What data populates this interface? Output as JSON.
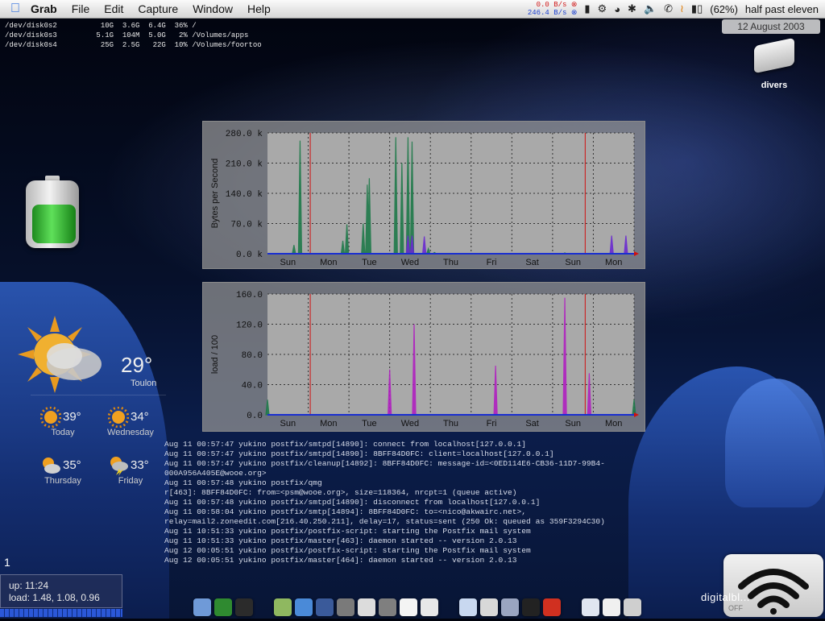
{
  "menubar": {
    "app_name": "Grab",
    "menus": [
      "File",
      "Edit",
      "Capture",
      "Window",
      "Help"
    ],
    "net_out": "0.0 B/s",
    "net_in": "246.4 B/s",
    "battery_percent": "(62%)",
    "clock": "half past eleven"
  },
  "date_widget": {
    "date": "12 August 2003"
  },
  "desktop": {
    "drive_label": "divers"
  },
  "df_output": [
    "/dev/disk0s2          10G  3.6G  6.4G  36% /",
    "/dev/disk0s3         5.1G  104M  5.0G   2% /Volumes/apps",
    "/dev/disk0s4          25G  2.5G   22G  10% /Volumes/foortoo"
  ],
  "battery_widget": {
    "level": 0.62
  },
  "network_graph": {
    "chart_data": {
      "type": "area",
      "ylabel": "Bytes per Second",
      "yticks": [
        "0.0 k",
        "70.0 k",
        "140.0 k",
        "210.0 k",
        "280.0 k"
      ],
      "ylim": [
        0,
        280
      ],
      "categories": [
        "Sun",
        "Mon",
        "Tue",
        "Wed",
        "Thu",
        "Fri",
        "Sat",
        "Sun",
        "Mon"
      ],
      "series": [
        {
          "color": "#1f7a4a",
          "points": [
            [
              0.65,
              20
            ],
            [
              0.8,
              262
            ],
            [
              1.85,
              30
            ],
            [
              1.95,
              68
            ],
            [
              2.35,
              70
            ],
            [
              2.45,
              160
            ],
            [
              2.5,
              175
            ],
            [
              3.15,
              270
            ],
            [
              3.3,
              210
            ],
            [
              3.45,
              270
            ],
            [
              3.55,
              260
            ],
            [
              3.95,
              12
            ],
            [
              4.1,
              3
            ],
            [
              7.3,
              2
            ]
          ]
        },
        {
          "color": "#6a2ad0",
          "points": [
            [
              3.45,
              42
            ],
            [
              3.55,
              42
            ],
            [
              3.85,
              40
            ],
            [
              4.0,
              0
            ],
            [
              8.45,
              42
            ],
            [
              8.8,
              42
            ]
          ]
        }
      ]
    }
  },
  "load_graph": {
    "chart_data": {
      "type": "area",
      "ylabel": "load / 100",
      "yticks": [
        "0.0",
        "40.0",
        "80.0",
        "120.0",
        "160.0"
      ],
      "ylim": [
        0,
        160
      ],
      "categories": [
        "Sun",
        "Mon",
        "Tue",
        "Wed",
        "Thu",
        "Fri",
        "Sat",
        "Sun",
        "Mon"
      ],
      "series": [
        {
          "color": "#b020c0",
          "points": [
            [
              3.6,
              120
            ],
            [
              7.3,
              155
            ],
            [
              3.0,
              60
            ],
            [
              5.6,
              65
            ],
            [
              7.9,
              55
            ]
          ]
        },
        {
          "color": "#1f7a4a",
          "points": [
            [
              0,
              20
            ],
            [
              9,
              20
            ]
          ]
        }
      ]
    }
  },
  "weather": {
    "current_temp": "29°",
    "city": "Toulon",
    "forecast": [
      {
        "day": "Today",
        "temp": "39°"
      },
      {
        "day": "Wednesday",
        "temp": "34°"
      },
      {
        "day": "Thursday",
        "temp": "35°"
      },
      {
        "day": "Friday",
        "temp": "33°"
      }
    ]
  },
  "log_lines": [
    "Aug 11 00:57:47 yukino postfix/smtpd[14890]: connect from localhost[127.0.0.1]",
    "Aug 11 00:57:47 yukino postfix/smtpd[14890]: 8BFF84D0FC: client=localhost[127.0.0.1]",
    "Aug 11 00:57:47 yukino postfix/cleanup[14892]: 8BFF84D0FC: message-id=<0ED114E6-CB36-11D7-99B4-",
    "000A956A405E@wooe.org>",
    "Aug 11 00:57:48 yukino postfix/qmg",
    "r[463]: 8BFF84D0FC: from=<psm@wooe.org>, size=118364, nrcpt=1 (queue active)",
    "Aug 11 00:57:48 yukino postfix/smtpd[14890]: disconnect from localhost[127.0.0.1]",
    "Aug 11 00:58:04 yukino postfix/smtp[14894]: 8BFF84D0FC: to=<nico@akwairc.net>,",
    "relay=mail2.zoneedit.com[216.40.250.211], delay=17, status=sent (250 Ok: queued as 359F3294C30)",
    "Aug 11 10:51:33 yukino postfix/postfix-script: starting the Postfix mail system",
    "Aug 11 10:51:33 yukino postfix/master[463]: daemon started -- version 2.0.13",
    "Aug 12 00:05:51 yukino postfix/postfix-script: starting the Postfix mail system",
    "Aug 12 00:05:51 yukino postfix/master[464]: daemon started -- version 2.0.13"
  ],
  "workspace_number": "1",
  "uptime": {
    "up": "up: 11:24",
    "load": "load: 1.48, 1.08, 0.96"
  },
  "dock": {
    "items": [
      {
        "icon": "finder-icon",
        "color": "#6f9ad8"
      },
      {
        "icon": "activity-monitor-icon",
        "color": "#2f8a30"
      },
      {
        "icon": "terminal-icon",
        "color": "#2b2b2b"
      },
      {
        "icon": "mail-icon",
        "color": "#8fb860"
      },
      {
        "icon": "safari-icon",
        "color": "#4a8ad8"
      },
      {
        "icon": "sherlock-icon",
        "color": "#3a5a9a"
      },
      {
        "icon": "system-prefs-icon",
        "color": "#7a7a7a"
      },
      {
        "icon": "ichat-icon",
        "color": "#dcdcdc"
      },
      {
        "icon": "disc-icon",
        "color": "#7f7f7f"
      },
      {
        "icon": "x11-icon",
        "color": "#f4f4f4"
      },
      {
        "icon": "textedit-icon",
        "color": "#e8e8e8"
      },
      {
        "icon": "clock-icon",
        "color": "#c8d8f0"
      },
      {
        "icon": "grab-icon",
        "color": "#d8d8d8"
      },
      {
        "icon": "dvd-icon",
        "color": "#9aa5c0"
      },
      {
        "icon": "record-icon",
        "color": "#222"
      },
      {
        "icon": "bug-icon",
        "color": "#d03020"
      },
      {
        "icon": "window-icon",
        "color": "#e0e6f0"
      },
      {
        "icon": "minimized-window-icon",
        "color": "#f0f0f0"
      },
      {
        "icon": "trash-icon",
        "color": "#cfcfcf"
      }
    ]
  },
  "wifi_widget": {
    "label": "digitalbl...",
    "status": "OFF"
  },
  "colors": {
    "net_out": "#d01a1a",
    "net_in": "#1a3fd0"
  }
}
